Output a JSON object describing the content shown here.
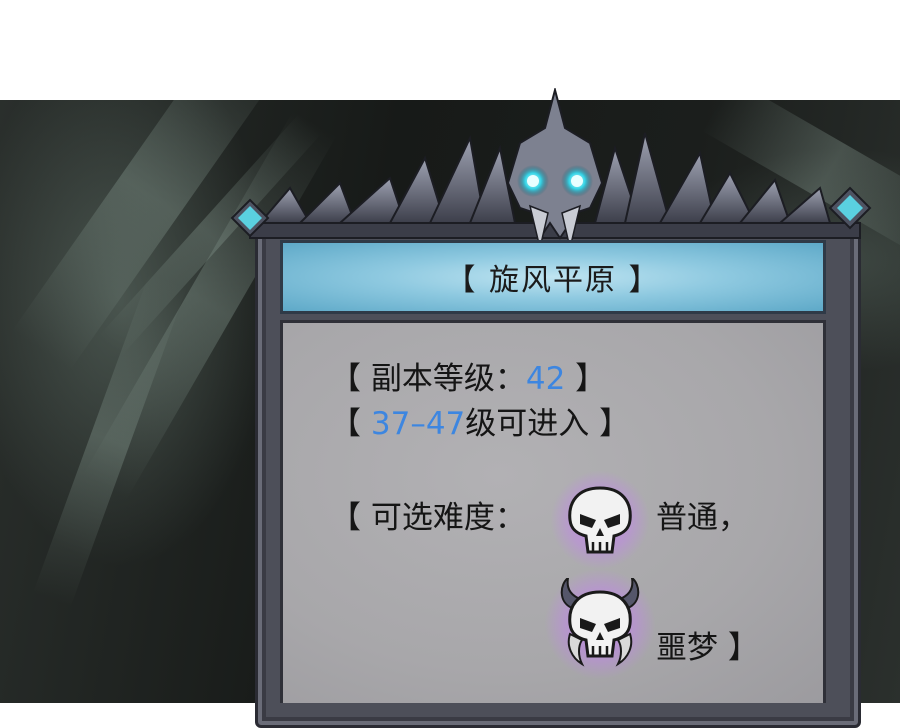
{
  "dungeon": {
    "title": "【 旋风平原 】",
    "level_prefix": "【 副本等级：",
    "level_value": "42",
    "level_suffix": " 】",
    "range_prefix": "【 ",
    "range_min": "37",
    "range_dash": "–",
    "range_max": "47",
    "range_suffix": "级可进入 】",
    "difficulty_label": "【 可选难度：",
    "difficulty_normal": "普通，",
    "difficulty_nightmare": "噩梦 】"
  },
  "icons": {
    "crown": "skull-crown-icon",
    "gem": "diamond-gem-icon",
    "normal": "skull-icon",
    "nightmare": "horned-skull-icon"
  },
  "colors": {
    "accent_blue": "#3d86e0",
    "title_bar": "#8ec9e0",
    "panel": "#a8a7aa",
    "frame": "#4d4f59",
    "eye_glow": "#35d4e6",
    "skull_glow": "#c878ff"
  }
}
